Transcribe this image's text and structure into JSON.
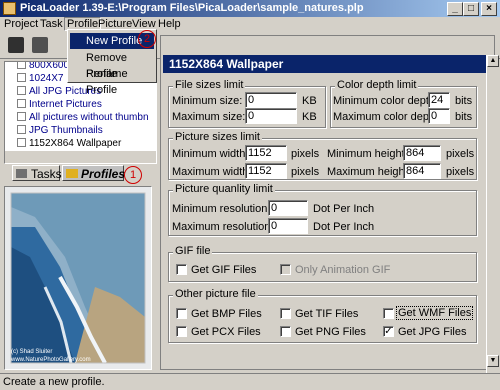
{
  "window": {
    "title": "PicaLoader 1.39-E:\\Program Files\\PicaLoader\\sample_natures.plp",
    "min": "_",
    "max": "□",
    "close": "×"
  },
  "menu": [
    "Project",
    "Task",
    "Profile",
    "Picture",
    "View",
    "Help"
  ],
  "popup": {
    "items": [
      "New Profile",
      "Remove Profile",
      "Rename Profile"
    ],
    "marker": "2"
  },
  "tree": {
    "items": [
      "800X600",
      "1024X7",
      "All JPG Pictures",
      "Internet Pictures",
      "All pictures without thumbn",
      "JPG Thumbnails",
      "1152X864 Wallpaper"
    ]
  },
  "tabs": {
    "tasks": "Tasks",
    "profiles": "Profiles",
    "marker": "1"
  },
  "image": {
    "credit1": "(c) Shad Sluiter",
    "credit2": "www.NaturePhotoGallery.com"
  },
  "panel": {
    "title": "1152X864 Wallpaper"
  },
  "filesize": {
    "caption": "File sizes limit",
    "min_label": "Minimum size:",
    "min_value": "0",
    "max_label": "Maximum size:",
    "max_value": "0",
    "unit": "KB",
    "unit2": "KB"
  },
  "color": {
    "caption": "Color depth limit",
    "min_label": "Minimum color depth:",
    "min_value": "24",
    "max_label": "Maximum color depth:",
    "max_value": "0",
    "unit": "bits",
    "unit2": "bits"
  },
  "picsize": {
    "caption": "Picture sizes limit",
    "minw_label": "Minimum width:",
    "minw": "1152",
    "maxw_label": "Maximum width:",
    "maxw": "1152",
    "minh_label": "Minimum height:",
    "minh": "864",
    "maxh_label": "Maximum height:",
    "maxh": "864",
    "unit": "pixels"
  },
  "quality": {
    "caption": "Picture quanlity limit",
    "minres_label": "Minimum resolution:",
    "minres": "0",
    "maxres_label": "Maximum resolution:",
    "maxres": "0",
    "unit": "Dot Per Inch"
  },
  "gif": {
    "caption": "GIF file",
    "get": "Get GIF Files",
    "anim": "Only Animation GIF"
  },
  "other": {
    "caption": "Other picture file",
    "bmp": "Get BMP Files",
    "pcx": "Get PCX Files",
    "tif": "Get TIF Files",
    "png": "Get PNG Files",
    "wmf": "Get WMF Files",
    "jpg": "Get JPG Files",
    "jpg_checked": true
  },
  "status": "Create a new profile.",
  "colors": {
    "accent": "#0a246a",
    "annotation": "#d00000"
  }
}
